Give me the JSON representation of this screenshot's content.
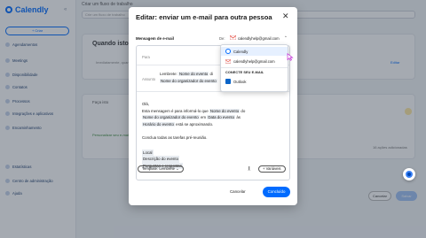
{
  "app": {
    "logo_text": "Calendly",
    "create_label": "+ Criar",
    "nav": [
      "Agendamentos",
      "Meetings",
      "Disponibilidade",
      "Contatos",
      "Processos",
      "Integrações e aplicativos",
      "Encaminhamento"
    ],
    "nav_bottom": [
      "Estatísticas",
      "Centro de administração",
      "Ajuda"
    ]
  },
  "background": {
    "workflow_title": "Criar um fluxo de trabalho",
    "workflow_name_placeholder": "Crie um fluxo de trabalho",
    "trigger_title": "Quando isto ac...",
    "trigger_line": "Imediatamente, quando um evento...",
    "edit_link": "Editar",
    "do_this_title": "Faça isto",
    "do_this_check": "Personalizar seu e-mail",
    "sent_count": "16 ações adicionadas",
    "cancel_label": "Cancelar",
    "save_label": "Salvar"
  },
  "modal": {
    "title": "Editar: enviar um e-mail para outra pessoa",
    "message_label": "Mensagem de e-mail",
    "from_label": "De:",
    "from_address": "calendlyhelp@gmail.com",
    "to_label": "Para",
    "subject_label": "Assunto",
    "subject_prefix": "Lembrete:",
    "subject_var1": "Nome do evento",
    "subject_var2": "Nome do organizador do evento",
    "subject_sep": "di",
    "body": {
      "greeting": "Olá,",
      "line1_a": "Esta mensagem é para informá-lo que",
      "line1_var": "Nome do evento",
      "line1_b": "do",
      "line2_var1": "Nome do organizador do evento",
      "line2_a": "em",
      "line2_var2": "Data do evento",
      "line2_b": "às",
      "line3_var": "Horário do evento",
      "line3_a": "está se aproximando.",
      "line4": "Conclua todas as tarefas pré-reunião.",
      "vars": [
        "Local",
        "Descrição do evento",
        "Perguntas e respostas"
      ]
    },
    "template_label": "Template: Lembrete",
    "variables_label": "+ Variáveis",
    "cancel_label": "Cancelar",
    "send_label": "Concluído"
  },
  "dropdown": {
    "items": [
      {
        "label": "Calendly",
        "selected": true
      },
      {
        "label": "calendlyhelp@gmail.com",
        "selected": false
      }
    ],
    "connect_header": "CONECTE SEU E-MAIL",
    "connect_items": [
      "Outlook"
    ]
  },
  "colors": {
    "accent": "#006bff",
    "overlay": "rgba(40,52,70,0.42)",
    "chip": "#e8ecf1",
    "selected": "#e6f0ff"
  }
}
